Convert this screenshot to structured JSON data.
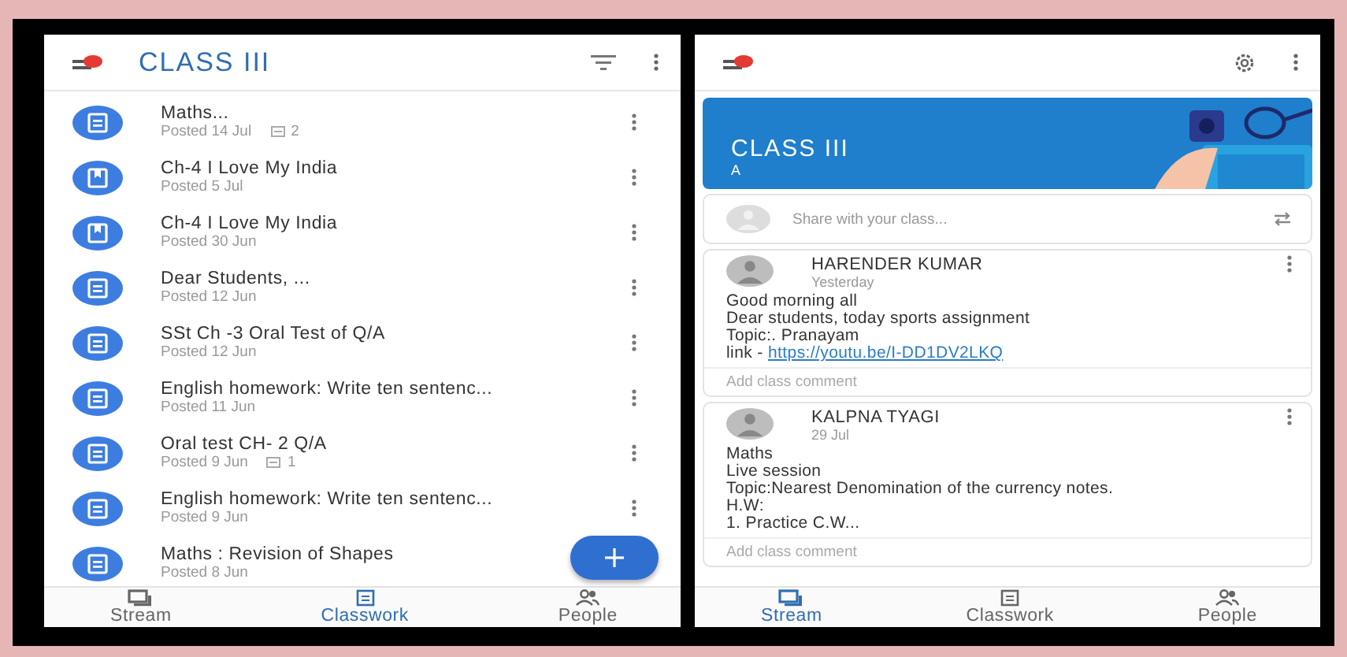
{
  "left": {
    "title": "CLASS III",
    "items": [
      {
        "kind": "assignment",
        "title": "Maths...",
        "posted": "Posted 14 Jul",
        "comments": "2"
      },
      {
        "kind": "material",
        "title": "Ch-4 I Love My India",
        "posted": "Posted 5 Jul"
      },
      {
        "kind": "material",
        "title": "Ch-4 I Love My India",
        "posted": "Posted 30 Jun"
      },
      {
        "kind": "assignment",
        "title": "Dear Students, ...",
        "posted": "Posted 12 Jun"
      },
      {
        "kind": "assignment",
        "title": "SSt  Ch -3 Oral Test of Q/A",
        "posted": "Posted 12 Jun"
      },
      {
        "kind": "assignment",
        "title": "English homework: Write ten sentenc...",
        "posted": "Posted 11 Jun"
      },
      {
        "kind": "assignment",
        "title": "Oral test CH- 2 Q/A",
        "posted": "Posted 9 Jun",
        "comments": "1"
      },
      {
        "kind": "assignment",
        "title": "English homework: Write ten sentenc...",
        "posted": "Posted 9 Jun"
      },
      {
        "kind": "assignment",
        "title": "Maths : Revision of Shapes",
        "posted": "Posted 8 Jun"
      }
    ],
    "nav": [
      {
        "kind": "stream",
        "label": "Stream",
        "selected": false
      },
      {
        "kind": "classwork",
        "label": "Classwork",
        "selected": true
      },
      {
        "kind": "people",
        "label": "People",
        "selected": false
      }
    ]
  },
  "right": {
    "banner": {
      "title": "CLASS III",
      "section": "A"
    },
    "share": {
      "prompt": "Share with your class..."
    },
    "posts": [
      {
        "author": "HARENDER KUMAR",
        "time": "Yesterday",
        "lines": [
          {
            "text": "Good morning all"
          },
          {
            "text": "Dear students, today sports assignment"
          },
          {
            "text": "Topic:. Pranayam"
          },
          {
            "text": "link - ",
            "link": "https://youtu.be/I-DD1DV2LKQ"
          }
        ],
        "comment": {
          "placeholder": "Add class comment"
        }
      },
      {
        "author": "KALPNA TYAGI",
        "time": "29 Jul",
        "lines": [
          {
            "text": "Maths"
          },
          {
            "text": "Live session"
          },
          {
            "text": "Topic:Nearest Denomination of the currency notes."
          },
          {
            "text": "H.W:"
          },
          {
            "text": "1. Practice C.W..."
          }
        ],
        "comment": {
          "placeholder": "Add class comment"
        }
      }
    ],
    "nav": [
      {
        "kind": "stream",
        "label": "Stream",
        "selected": true
      },
      {
        "kind": "classwork",
        "label": "Classwork",
        "selected": false
      },
      {
        "kind": "people",
        "label": "People",
        "selected": false
      }
    ]
  }
}
